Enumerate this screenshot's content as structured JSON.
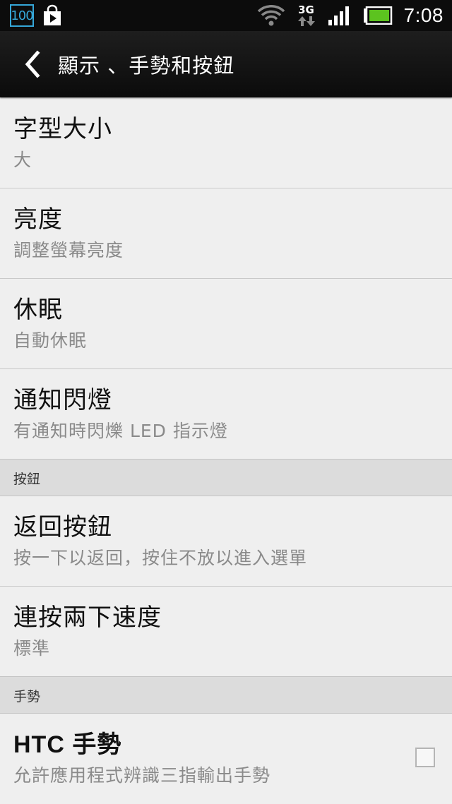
{
  "status_bar": {
    "badge": "100",
    "time": "7:08",
    "network": "3G",
    "battery_color": "#5cc31f"
  },
  "header": {
    "title": "顯示 、手勢和按鈕"
  },
  "items": [
    {
      "title": "字型大小",
      "subtitle": "大"
    },
    {
      "title": "亮度",
      "subtitle": "調整螢幕亮度"
    },
    {
      "title": "休眠",
      "subtitle": "自動休眠"
    },
    {
      "title": "通知閃燈",
      "subtitle": "有通知時閃爍 LED 指示燈"
    }
  ],
  "section_buttons": {
    "label": "按鈕",
    "items": [
      {
        "title": "返回按鈕",
        "subtitle": "按一下以返回，按住不放以進入選單"
      },
      {
        "title": "連按兩下速度",
        "subtitle": "標準"
      }
    ]
  },
  "section_gestures": {
    "label": "手勢",
    "items": [
      {
        "title": "HTC 手勢",
        "subtitle": "允許應用程式辨識三指輸出手勢",
        "checked": false
      }
    ]
  }
}
